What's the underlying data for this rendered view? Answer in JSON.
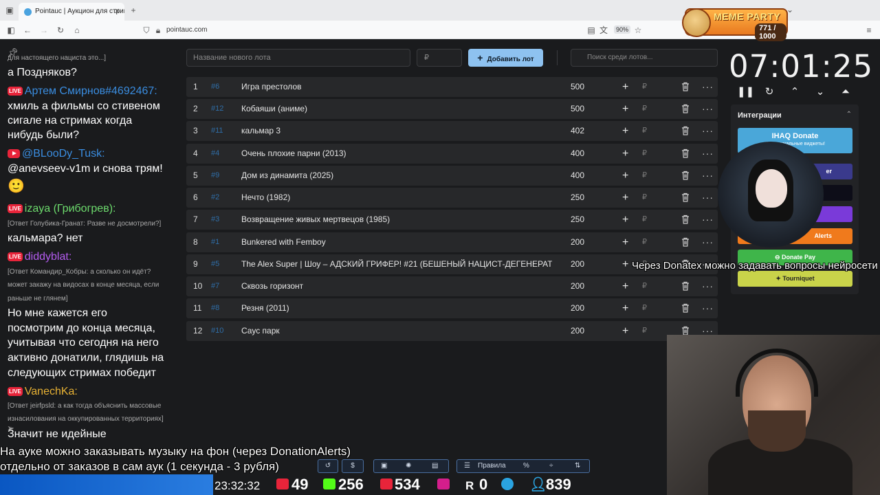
{
  "browser": {
    "tab_title": "Pointauc | Аукцион для стримеров",
    "url": "pointauc.com",
    "zoom": "90%"
  },
  "meme_party": {
    "title": "MEME PARTY",
    "count": "771 / 1000"
  },
  "chat": [
    {
      "text": "для настоящего нациста это...]",
      "kind": "reply"
    },
    {
      "text": "а Поздняков?",
      "kind": "msg"
    },
    {
      "text": "Артем Смирнов#4692467:",
      "kind": "user",
      "color": "#3a8de0"
    },
    {
      "text": "хмиль а фильмы со стивеном",
      "kind": "msg"
    },
    {
      "text": "сигале на стримах когда",
      "kind": "msg"
    },
    {
      "text": "нибудь были?",
      "kind": "msg"
    },
    {
      "text": "@BLooDy_Tusk:",
      "kind": "user",
      "color": "#3a8de0"
    },
    {
      "text": "@anevseev-v1m и снова трям!",
      "kind": "msg"
    },
    {
      "text": "🙂",
      "kind": "msg"
    },
    {
      "text": "izaya (Грибогрев):",
      "kind": "user",
      "color": "#6ddc6d"
    },
    {
      "text": "[Ответ Голубика-Гранат: Разве не досмотрели?]",
      "kind": "reply"
    },
    {
      "text": "кальмара? нет",
      "kind": "msg"
    },
    {
      "text": "diddyblat:",
      "kind": "user",
      "color": "#b45cf0"
    },
    {
      "text": "[Ответ Командир_Кобры: а сколько он идёт?",
      "kind": "reply"
    },
    {
      "text": "может закажу на видосах в конце месяца, если",
      "kind": "reply"
    },
    {
      "text": "раньше не глянем]",
      "kind": "reply"
    },
    {
      "text": "Но мне кажется его",
      "kind": "msg"
    },
    {
      "text": "посмотрим до конца месяца,",
      "kind": "msg"
    },
    {
      "text": "учитывая что сегодня на него",
      "kind": "msg"
    },
    {
      "text": "активно донатили, глядишь на",
      "kind": "msg"
    },
    {
      "text": "следующих стримах победит",
      "kind": "msg"
    },
    {
      "text": "VanechKa:",
      "kind": "user",
      "color": "#e8b234"
    },
    {
      "text": "[Ответ jeirfpsld: а как тогда объяснить массовые",
      "kind": "reply"
    },
    {
      "text": "изнасилования на оккупированных территориях]",
      "kind": "reply"
    },
    {
      "text": "Значит не идейные",
      "kind": "msg"
    }
  ],
  "controls": {
    "new_lot_placeholder": "Название нового лота",
    "price_placeholder": "₽",
    "add_button": "Добавить лот",
    "search_placeholder": "Поиск среди лотов..."
  },
  "lots": [
    {
      "num": "1",
      "id": "#6",
      "name": "Игра престолов",
      "amount": "500"
    },
    {
      "num": "2",
      "id": "#12",
      "name": "Кобаяши (аниме)",
      "amount": "500"
    },
    {
      "num": "3",
      "id": "#11",
      "name": "кальмар 3",
      "amount": "402"
    },
    {
      "num": "4",
      "id": "#4",
      "name": "Очень плохие парни (2013)",
      "amount": "400"
    },
    {
      "num": "5",
      "id": "#9",
      "name": "Дом из динамита (2025)",
      "amount": "400"
    },
    {
      "num": "6",
      "id": "#2",
      "name": "Нечто (1982)",
      "amount": "250"
    },
    {
      "num": "7",
      "id": "#3",
      "name": "Возвращение живых мертвецов (1985)",
      "amount": "250"
    },
    {
      "num": "8",
      "id": "#1",
      "name": "Bunkered with Femboy",
      "amount": "200"
    },
    {
      "num": "9",
      "id": "#5",
      "name": "The Alex Super | Шоу – АДСКИЙ ГРИФЕР! #21 (БЕШЕНЫЙ НАЦИСТ-ДЕГЕНЕРАТ",
      "amount": "200"
    },
    {
      "num": "10",
      "id": "#7",
      "name": "Сквозь горизонт",
      "amount": "200"
    },
    {
      "num": "11",
      "id": "#8",
      "name": "Резня (2011)",
      "amount": "200"
    },
    {
      "num": "12",
      "id": "#10",
      "name": "Саус парк",
      "amount": "200"
    }
  ],
  "row_symbols": {
    "plus": "+",
    "rub": "₽",
    "more": "···"
  },
  "timer": "07:01:25",
  "integrations": {
    "title": "Интеграции",
    "ihaq": "IHAQ Donate",
    "ihaq_sub": "Ко... уникальные виджеты!",
    "btn2": "er",
    "btn5": "Alerts",
    "donatepay": "Donate Pay",
    "tourniquet": "Tourniquet"
  },
  "captions": {
    "donatex": "Через Donatex можно задавать вопросы нейросети",
    "music1": "На ауке можно заказывать музыку на фон (через DonationAlerts)",
    "music2": "отдельно от заказов в сам аук (1 секунда - 3 рубля)"
  },
  "bottom_toolbar": {
    "rules": "Правила",
    "dollar": "$",
    "percent": "%"
  },
  "status": {
    "clock": "23:32:32",
    "youtube": "49",
    "kick": "256",
    "live": "534",
    "r_count": "0",
    "viewers": "839"
  },
  "colors": {
    "accent": "#8ec2f0",
    "lot_id": "#2f6ea8",
    "row_bg": "#27282a",
    "donatepay": "#3fb54a",
    "tourniquet": "#c9d34a"
  }
}
